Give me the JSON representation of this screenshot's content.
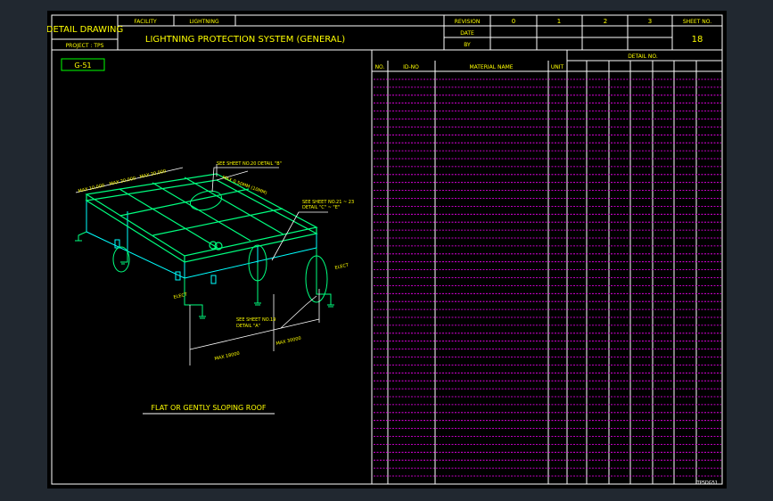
{
  "title_block": {
    "detail_drawing": "DETAIL DRAWING",
    "project": "PROJECT : TPS",
    "facility_label": "FACILITY",
    "facility_value": "LIGHTNING",
    "title": "LIGHTNING PROTECTION SYSTEM (GENERAL)",
    "revision_label": "REVISION",
    "date_label": "DATE",
    "by_label": "BY",
    "revisions": [
      "0",
      "1",
      "2",
      "3"
    ],
    "sheet_label": "SHEET NO.",
    "sheet_no": "18"
  },
  "drawing": {
    "code": "G-51",
    "caption": "FLAT OR GENTLY SLOPING ROOF",
    "note_top": "SEE SHEET NO.20 DETAIL \"B\"",
    "note_right_1": "SEE SHEET NO.21 ~ 23",
    "note_right_2": "DETAIL \"C\" ~ \"E\"",
    "note_bottom_1": "SEE SHEET NO.19",
    "note_bottom_2": "DETAIL \"A\"",
    "dim_max_1": "MAX 10,000",
    "dim_max_2": "MAX 20,000",
    "dim_max_3": "MAX 20,000",
    "dim_width": "MAX 0.50MM (10MM)",
    "dim_bottom_1": "MAX 18000",
    "dim_bottom_2": "MAX 30000",
    "elec_1": "ELECT",
    "elec_2": "ELECT"
  },
  "material_table": {
    "col_no": "NO.",
    "col_id": "ID-NO",
    "col_name": "MATERIAL NAME",
    "col_unit": "UNIT",
    "col_detail": "DETAIL NO."
  },
  "footer_code": "TPSDG51",
  "colors": {
    "frame": "#ffffff",
    "text": "#ffff00",
    "roof": "#00ff7f",
    "building": "#00ffff",
    "rows": "#ff00ff",
    "code_box": "#00ff00"
  }
}
